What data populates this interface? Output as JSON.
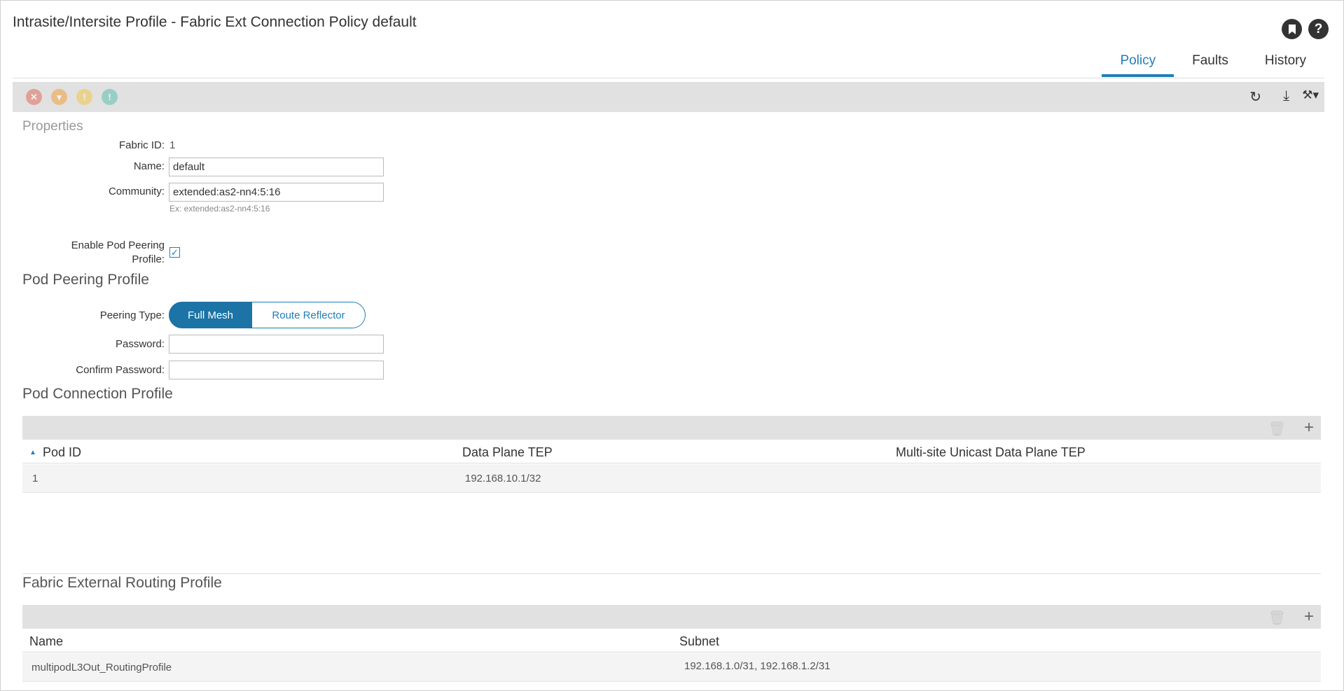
{
  "page": {
    "title": "Intrasite/Intersite Profile - Fabric Ext Connection Policy default",
    "bookmark_icon": "bookmark-icon",
    "help_icon": "help-icon"
  },
  "tabs": [
    {
      "label": "Policy",
      "active": true
    },
    {
      "label": "Faults",
      "active": false
    },
    {
      "label": "History",
      "active": false
    }
  ],
  "toolbar": {
    "faults": [
      {
        "icon": "critical-fault-icon",
        "color": "#e06b5e",
        "glyph": "✕"
      },
      {
        "icon": "major-fault-icon",
        "color": "#f0a13c",
        "glyph": "▾"
      },
      {
        "icon": "minor-fault-icon",
        "color": "#f3c64b",
        "glyph": "!"
      },
      {
        "icon": "warning-fault-icon",
        "color": "#5fbfb0",
        "glyph": "!"
      }
    ],
    "refresh_icon": "refresh-icon",
    "download_icon": "download-icon",
    "tools_icon": "tools-icon"
  },
  "properties": {
    "heading": "Properties",
    "fabric_id_label": "Fabric ID:",
    "fabric_id_value": "1",
    "name_label": "Name:",
    "name_value": "default",
    "community_label": "Community:",
    "community_value": "extended:as2-nn4:5:16",
    "community_hint": "Ex: extended:as2-nn4:5:16",
    "enable_pod_peering_label_1": "Enable Pod Peering",
    "enable_pod_peering_label_2": "Profile:",
    "enable_pod_peering_checked": true
  },
  "pod_peering": {
    "heading": "Pod Peering Profile",
    "peering_type_label": "Peering Type:",
    "options": [
      "Full Mesh",
      "Route Reflector"
    ],
    "selected": "Full Mesh",
    "password_label": "Password:",
    "password_value": "",
    "confirm_password_label": "Confirm Password:",
    "confirm_password_value": ""
  },
  "pod_connection": {
    "heading": "Pod Connection Profile",
    "columns": [
      "Pod ID",
      "Data Plane TEP",
      "Multi-site Unicast Data Plane TEP"
    ],
    "rows": [
      [
        "1",
        "192.168.10.1/32",
        ""
      ]
    ]
  },
  "fabric_external": {
    "heading": "Fabric External Routing Profile",
    "columns": [
      "Name",
      "Subnet"
    ],
    "rows": [
      [
        "multipodL3Out_RoutingProfile",
        "192.168.1.0/31, 192.168.1.2/31"
      ]
    ]
  }
}
